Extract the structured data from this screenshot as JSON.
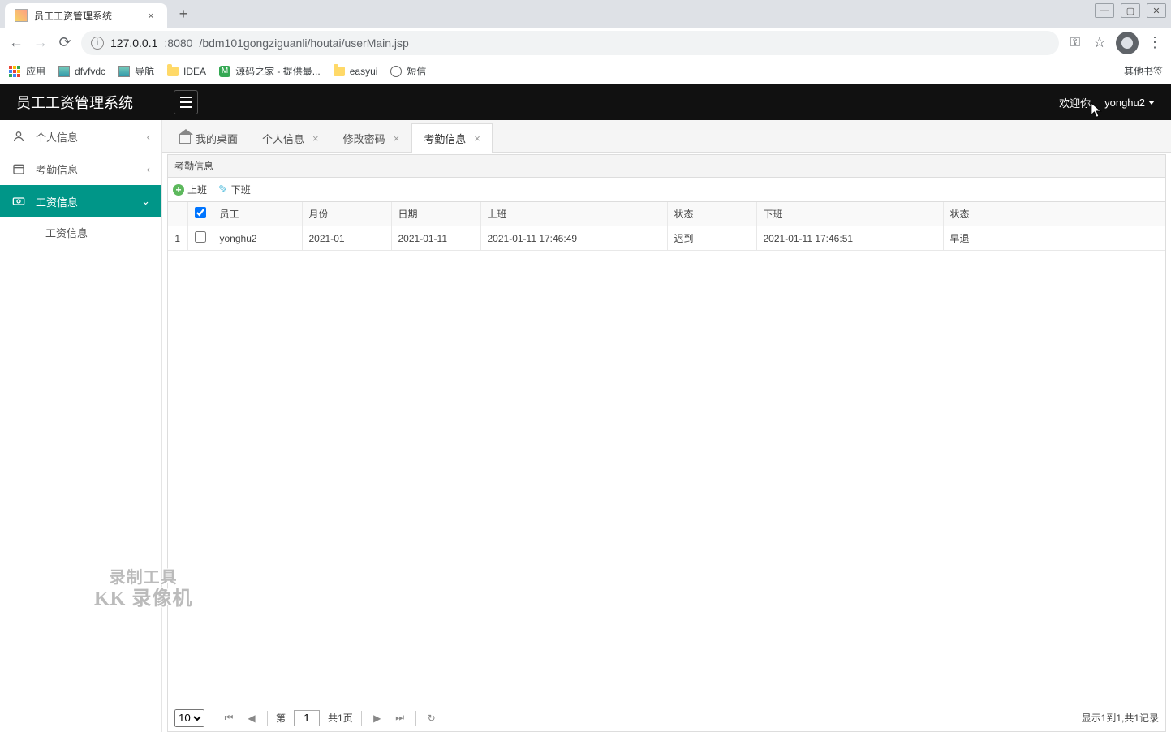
{
  "browser": {
    "tab_title": "员工工资管理系统",
    "url_host": "127.0.0.1",
    "url_port": ":8080",
    "url_path": "/bdm101gongziguanli/houtai/userMain.jsp",
    "bookmarks": {
      "apps": "应用",
      "b1": "dfvfvdc",
      "b2": "导航",
      "b3": "IDEA",
      "b4": "源码之家 - 提供最...",
      "b5": "easyui",
      "b6": "短信",
      "other": "其他书签"
    }
  },
  "app": {
    "title": "员工工资管理系统",
    "welcome_prefix": "欢迎你，",
    "username": "yonghu2"
  },
  "sidebar": {
    "items": [
      {
        "label": "个人信息"
      },
      {
        "label": "考勤信息"
      },
      {
        "label": "工资信息"
      }
    ],
    "sub": {
      "label": "工资信息"
    }
  },
  "tabs": {
    "t0": "我的桌面",
    "t1": "个人信息",
    "t2": "修改密码",
    "t3": "考勤信息"
  },
  "panel": {
    "title": "考勤信息",
    "btn_on": "上班",
    "btn_off": "下班"
  },
  "table": {
    "headers": {
      "emp": "员工",
      "month": "月份",
      "date": "日期",
      "on": "上班",
      "on_status": "状态",
      "off": "下班",
      "off_status": "状态"
    },
    "rows": [
      {
        "idx": "1",
        "emp": "yonghu2",
        "month": "2021-01",
        "date": "2021-01-11",
        "on": "2021-01-11 17:46:49",
        "on_status": "迟到",
        "off": "2021-01-11 17:46:51",
        "off_status": "早退"
      }
    ]
  },
  "pager": {
    "size": "10",
    "page_label": "第",
    "page": "1",
    "total_pages": "共1页",
    "info": "显示1到1,共1记录"
  },
  "watermark": {
    "line1": "录制工具",
    "line2": "KK 录像机"
  }
}
